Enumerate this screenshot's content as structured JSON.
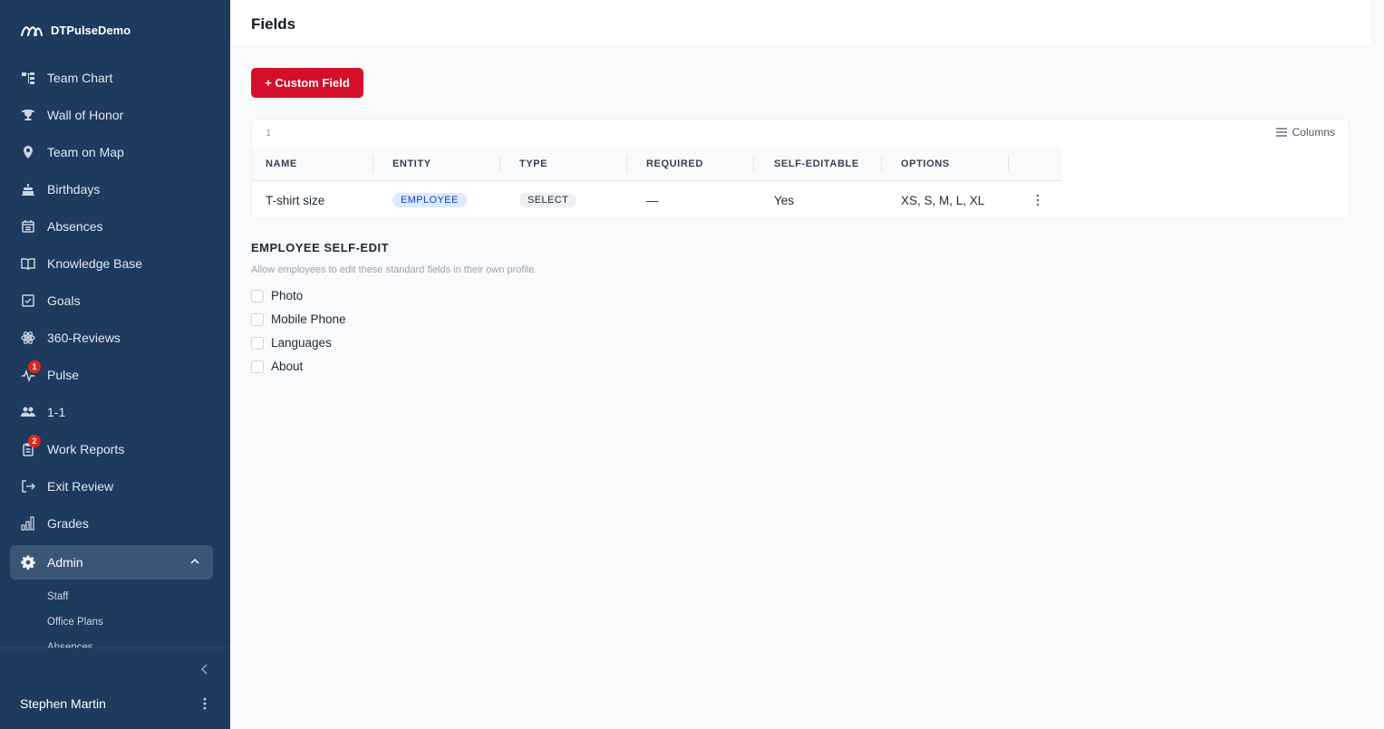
{
  "brand": {
    "name": "DTPulseDemo"
  },
  "sidebar": {
    "items": [
      {
        "label": "Team Chart",
        "icon": "org-chart-icon"
      },
      {
        "label": "Wall of Honor",
        "icon": "trophy-icon"
      },
      {
        "label": "Team on Map",
        "icon": "map-pin-icon"
      },
      {
        "label": "Birthdays",
        "icon": "cake-icon"
      },
      {
        "label": "Absences",
        "icon": "calendar-icon"
      },
      {
        "label": "Knowledge Base",
        "icon": "book-icon"
      },
      {
        "label": "Goals",
        "icon": "checkbox-icon"
      },
      {
        "label": "360-Reviews",
        "icon": "atom-icon"
      },
      {
        "label": "Pulse",
        "icon": "pulse-icon",
        "badge": "1"
      },
      {
        "label": "1-1",
        "icon": "users-icon"
      },
      {
        "label": "Work Reports",
        "icon": "clipboard-icon",
        "badge": "2"
      },
      {
        "label": "Exit Review",
        "icon": "exit-icon"
      },
      {
        "label": "Grades",
        "icon": "bar-chart-icon"
      }
    ],
    "active": {
      "label": "Admin",
      "icon": "gear-icon"
    },
    "subitems": [
      "Staff",
      "Office Plans",
      "Absences"
    ],
    "user": "Stephen Martin"
  },
  "header": {
    "title": "Fields"
  },
  "toolbar": {
    "add_label": "+ Custom Field"
  },
  "table": {
    "count": "1",
    "columns_label": "Columns",
    "headers": [
      "NAME",
      "ENTITY",
      "TYPE",
      "REQUIRED",
      "SELF-EDITABLE",
      "OPTIONS"
    ],
    "rows": [
      {
        "name": "T-shirt size",
        "entity": "EMPLOYEE",
        "type": "SELECT",
        "required": "—",
        "self_editable": "Yes",
        "options": "XS, S, M, L, XL"
      }
    ]
  },
  "self_edit": {
    "title": "EMPLOYEE SELF-EDIT",
    "help": "Allow employees to edit these standard fields in their own profile.",
    "fields": [
      "Photo",
      "Mobile Phone",
      "Languages",
      "About"
    ]
  },
  "colors": {
    "sidebar": "#1e3a5f",
    "accent": "#d50f2a",
    "active_item": "#3a5576"
  }
}
